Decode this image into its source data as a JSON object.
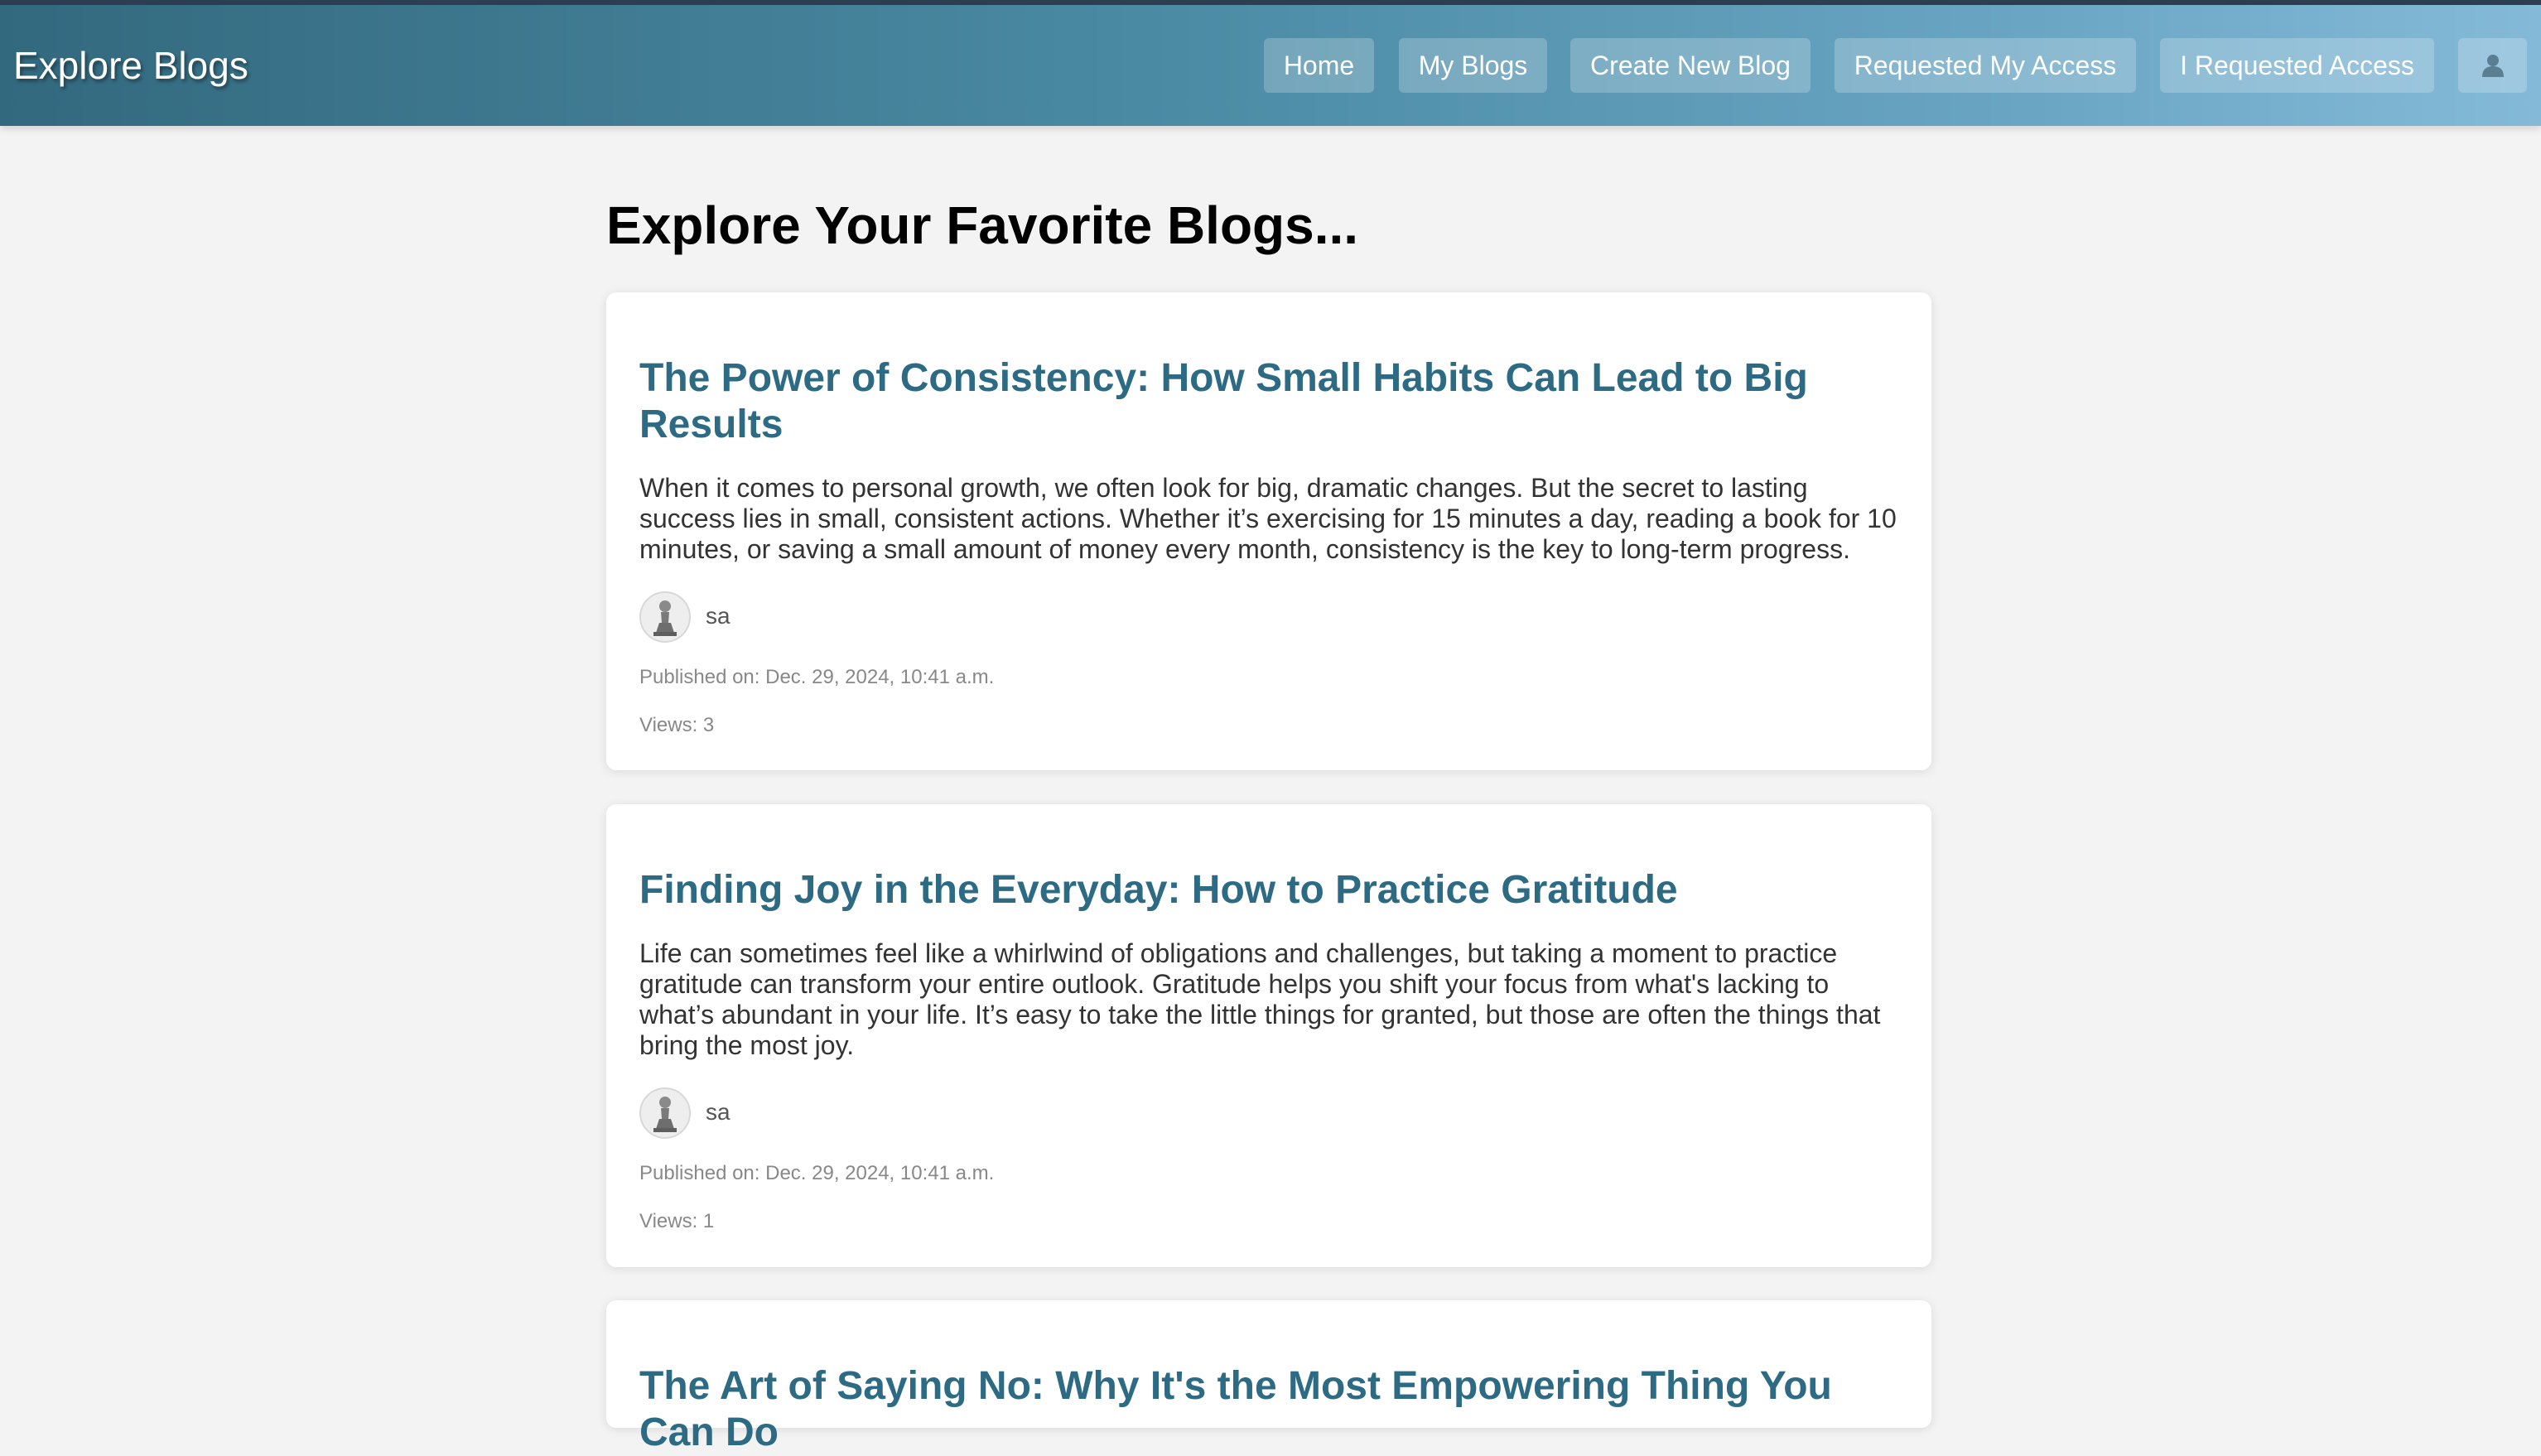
{
  "header": {
    "brand": "Explore Blogs",
    "nav": {
      "home": "Home",
      "my_blogs": "My Blogs",
      "create_new_blog": "Create New Blog",
      "requested_my_access": "Requested My Access",
      "i_requested_access": "I Requested Access",
      "profile_icon": "user-icon"
    }
  },
  "main": {
    "title": "Explore Your Favorite Blogs...",
    "posts": [
      {
        "title": "The Power of Consistency: How Small Habits Can Lead to Big Results",
        "excerpt": "When it comes to personal growth, we often look for big, dramatic changes. But the secret to lasting success lies in small, consistent actions. Whether it’s exercising for 15 minutes a day, reading a book for 10 minutes, or saving a small amount of money every month, consistency is the key to long-term progress.",
        "author": "sa",
        "published": "Published on: Dec. 29, 2024, 10:41 a.m.",
        "views": "Views: 3"
      },
      {
        "title": "Finding Joy in the Everyday: How to Practice Gratitude",
        "excerpt": "Life can sometimes feel like a whirlwind of obligations and challenges, but taking a moment to practice gratitude can transform your entire outlook. Gratitude helps you shift your focus from what's lacking to what’s abundant in your life. It’s easy to take the little things for granted, but those are often the things that bring the most joy.",
        "author": "sa",
        "published": "Published on: Dec. 29, 2024, 10:41 a.m.",
        "views": "Views: 1"
      },
      {
        "title": "The Art of Saying No: Why It's the Most Empowering Thing You Can Do"
      }
    ]
  },
  "colors": {
    "header_gradient_start": "#33697f",
    "header_gradient_end": "#84bad8",
    "post_title": "#2d6b85",
    "page_background": "#f3f3f3"
  }
}
